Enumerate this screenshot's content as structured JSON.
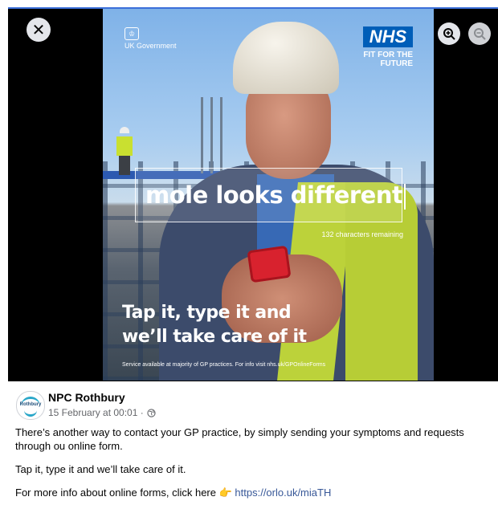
{
  "ad": {
    "gov_label": "UK Government",
    "nhs_label": "NHS",
    "fit_line1": "FIT FOR THE",
    "fit_line2": "FUTURE",
    "typed_text": "mole looks different",
    "remaining_text": "132 characters remaining",
    "tagline_line1": "Tap it, type it and",
    "tagline_line2": "we’ll take care of it",
    "footnote": "Service available at majority of GP practices. For info visit nhs.uk/GPOnlineForms"
  },
  "viewer": {
    "close_label": "✕",
    "zoom_in_icon": "zoom-in-icon",
    "zoom_out_icon": "zoom-out-icon"
  },
  "post": {
    "author": "NPC Rothbury",
    "avatar_text": "Rothbury",
    "timestamp": "15 February at 00:01 ·",
    "audience_icon": "globe-icon",
    "paragraph1": "There’s another way to contact your GP practice, by simply sending your symptoms and requests through ou online form.",
    "paragraph2": "Tap it, type it and we’ll take care of it.",
    "paragraph3_prefix": "For more info about online forms, click here 👉 ",
    "link_text": "https://orlo.uk/miaTH"
  },
  "colors": {
    "nhs_blue": "#005eb8",
    "link": "#385898",
    "frame_border": "#3b6fd9"
  }
}
